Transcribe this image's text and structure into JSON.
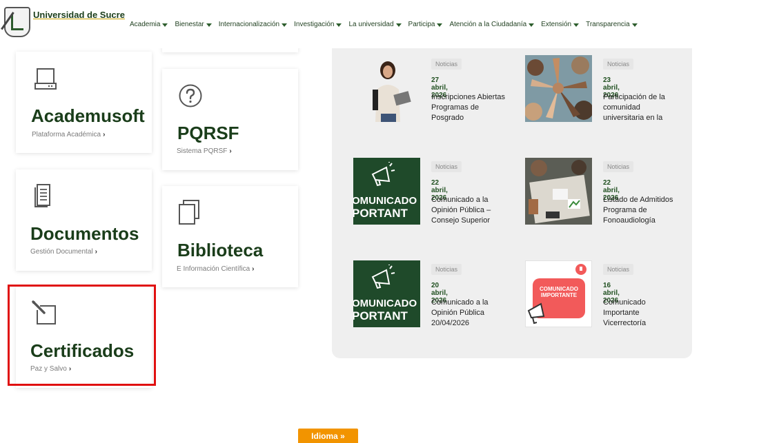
{
  "header": {
    "brand": "Universidad de Sucre",
    "nav": [
      "Academia",
      "Bienestar",
      "Internacionalización",
      "Investigación",
      "La universidad",
      "Participa",
      "Atención a la Ciudadanía",
      "Extensión",
      "Transparencia"
    ]
  },
  "cards": {
    "academusoft": {
      "title": "Academusoft",
      "sub": "Plataforma Académica",
      "icon": "hard-drive-icon"
    },
    "pqrsf": {
      "title": "PQRSF",
      "sub": "Sistema PQRSF",
      "icon": "question-circle-icon"
    },
    "documentos": {
      "title": "Documentos",
      "sub": "Gestión Documental",
      "icon": "document-icon"
    },
    "biblioteca": {
      "title": "Biblioteca",
      "sub": "E Información Científica",
      "icon": "copy-icon"
    },
    "certificados": {
      "title": "Certificados",
      "sub": "Paz y Salvo",
      "icon": "edit-icon"
    }
  },
  "news": [
    {
      "cat": "Noticias",
      "date": "27 abril, 2026",
      "title": "Inscripciones Abiertas Programas de Posgrado"
    },
    {
      "cat": "Noticias",
      "date": "23 abril, 2026",
      "title": "Participación de la comunidad universitaria en la construcción de"
    },
    {
      "cat": "Noticias",
      "date": "22 abril, 2026",
      "title": "Comunicado a la Opinión Pública – Consejo Superior Universitario"
    },
    {
      "cat": "Noticias",
      "date": "22 abril, 2026",
      "title": "Listado de Admitidos Programa de Fonoaudiología"
    },
    {
      "cat": "Noticias",
      "date": "20 abril, 2026",
      "title": "Comunicado a la Opinión Pública 20/04/2026"
    },
    {
      "cat": "Noticias",
      "date": "16 abril, 2026",
      "title": "Comunicado Importante Vicerrectoría Académica"
    }
  ],
  "thumbs": {
    "comm_l1": "OMUNICADO",
    "comm_l2": "PORTANT",
    "badge_l1": "COMUNICADO",
    "badge_l2": "IMPORTANTE"
  },
  "footer": {
    "idioma": "Idioma »"
  },
  "colors": {
    "brand_green": "#1a3d1a",
    "accent_orange": "#f29400",
    "access_blue": "#2749a8",
    "highlight_red": "#e01010"
  }
}
